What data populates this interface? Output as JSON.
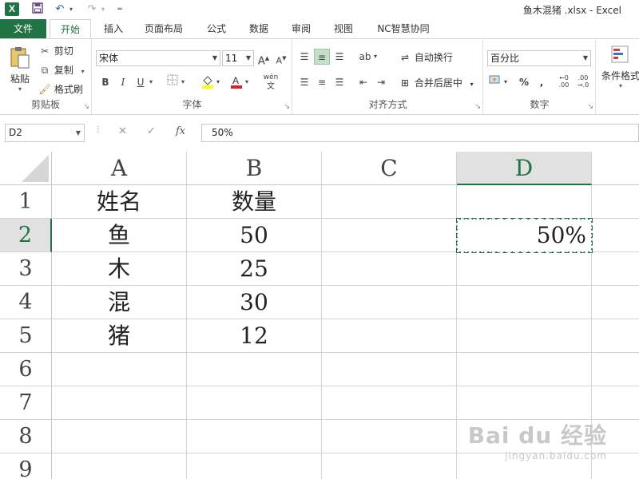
{
  "window": {
    "title": "鱼木混猪 .xlsx - Excel",
    "icons": [
      "excel-logo",
      "save-icon",
      "undo-icon",
      "redo-icon",
      "customize-qat-icon"
    ]
  },
  "tabs": [
    {
      "label": "文件"
    },
    {
      "label": "开始"
    },
    {
      "label": "插入"
    },
    {
      "label": "页面布局"
    },
    {
      "label": "公式"
    },
    {
      "label": "数据"
    },
    {
      "label": "审阅"
    },
    {
      "label": "视图"
    },
    {
      "label": "NC智慧协同"
    }
  ],
  "ribbon": {
    "clipboard": {
      "label": "剪贴板",
      "paste": "粘贴",
      "cut": "剪切",
      "copy": "复制",
      "format_painter": "格式刷"
    },
    "font": {
      "label": "字体",
      "font_name": "宋体",
      "font_size": "11",
      "bold": "B",
      "italic": "I",
      "underline": "U",
      "phonetic": "wén"
    },
    "alignment": {
      "label": "对齐方式",
      "wrap_text": "自动换行",
      "merge_center": "合并后居中"
    },
    "number": {
      "label": "数字",
      "format": "百分比"
    },
    "styles": {
      "conditional_format": "条件格式"
    }
  },
  "formula_bar": {
    "name_box": "D2",
    "fx_label": "fx",
    "content": "50%"
  },
  "sheet": {
    "columns": [
      "A",
      "B",
      "C",
      "D"
    ],
    "rows": [
      "1",
      "2",
      "3",
      "4",
      "5",
      "6",
      "7",
      "8",
      "9"
    ],
    "active_cell": "D2",
    "cells": {
      "A1": "姓名",
      "B1": "数量",
      "A2": "鱼",
      "B2": "50",
      "D2": "50%",
      "A3": "木",
      "B3": "25",
      "A4": "混",
      "B4": "30",
      "A5": "猪",
      "B5": "12"
    }
  },
  "watermark": {
    "main": "Bai du 经验",
    "sub": "jingyan.baidu.com"
  },
  "colors": {
    "excel_green": "#217346",
    "selected_header_bg": "#e1e1e1"
  }
}
